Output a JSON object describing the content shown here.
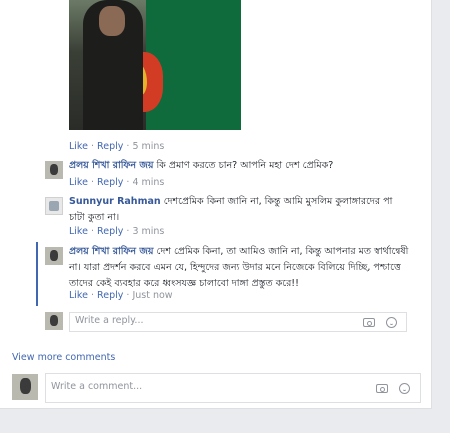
{
  "meta_sep": "·",
  "photo_comment": {
    "like": "Like",
    "reply": "Reply",
    "time": "5 mins"
  },
  "comments": [
    {
      "author": "প্রলয় শিখা রাফিন জয়",
      "text": "কি প্রমাণ করতে চান? আপনি মহা দেশ প্রেমিক?",
      "like": "Like",
      "reply": "Reply",
      "time": "4 mins"
    },
    {
      "author": "Sunnyur Rahman",
      "text": "দেশপ্রেমিক কিনা জানি না, কিন্তু আমি মুসলিম কুলাঙ্গারদের পা চাটা কুতা না।",
      "like": "Like",
      "reply": "Reply",
      "time": "3 mins"
    },
    {
      "author": "প্রলয় শিখা রাফিন জয়",
      "text": "দেশ প্রেমিক কিনা, তা আমিও জানি না, কিন্তু আপনার মত স্বার্থান্বেষী না। যারা প্রদর্শন করবে এমন যে, হিন্দুদের জন্য উদার মনে নিজেকে বিলিয়ে দিচ্ছি, পশ্চাত্তে তাদের কেই ব্যবহার করে ধ্বংসযজ্ঞ চালাবো দাঙ্গা প্রস্তুত করে!!",
      "like": "Like",
      "reply": "Reply",
      "time": "Just now"
    }
  ],
  "reply_box": {
    "placeholder": "Write a reply..."
  },
  "view_more": "View more comments",
  "comment_box": {
    "placeholder": "Write a comment..."
  },
  "icons": {
    "camera": "camera-icon",
    "emoji": "emoji-icon"
  },
  "colors": {
    "link": "#4267b2",
    "author": "#365899",
    "meta": "#90949c"
  }
}
